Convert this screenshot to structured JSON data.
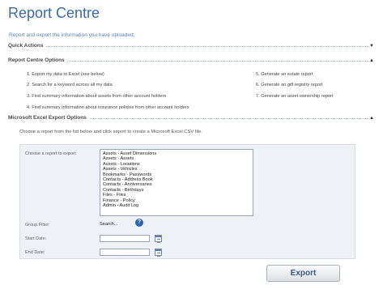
{
  "page": {
    "title": "Report Centre",
    "subtitle": "Report and export the information you have uploaded."
  },
  "sections": {
    "quick_actions": "Quick Actions",
    "report_options": "Report Centre Options",
    "excel_options": "Microsoft Excel Export Options",
    "collapse_arrow": "▲",
    "expand_arrow": "▼"
  },
  "options": {
    "left": [
      "1. Export my data to Excel (see below)",
      "2. Search for a keyword across all my data",
      "3. Find summary information about assets from other account holders",
      "4. Find summary information about insurance policies from other account holders"
    ],
    "right": [
      "5. Generate an estate report",
      "6. Generate an gift registry report",
      "7. Generate an asset ownership report"
    ]
  },
  "export": {
    "instructions": "Choose a report from the list below and click export to create a Microsoft Excel CSV file.",
    "choose_label": "Choose a report to export:",
    "reports": [
      "Assets - Asset Dimensions",
      "Assets - Assets",
      "Assets - Locations",
      "Assets - Vehicles",
      "Bookmarks - Passwords",
      "Contacts - Address Book",
      "Contacts - Anniversaries",
      "Contacts - Birthdays",
      "Files - Files",
      "Finance - Policy",
      "Admin - Audit Log"
    ],
    "group_filter_label": "Group Filter:",
    "group_filter_value": "Search...",
    "help_icon": "?",
    "start_date_label": "Start Date:",
    "start_date_value": "",
    "end_date_label": "End Date:",
    "end_date_value": "",
    "button_label": "Export"
  }
}
